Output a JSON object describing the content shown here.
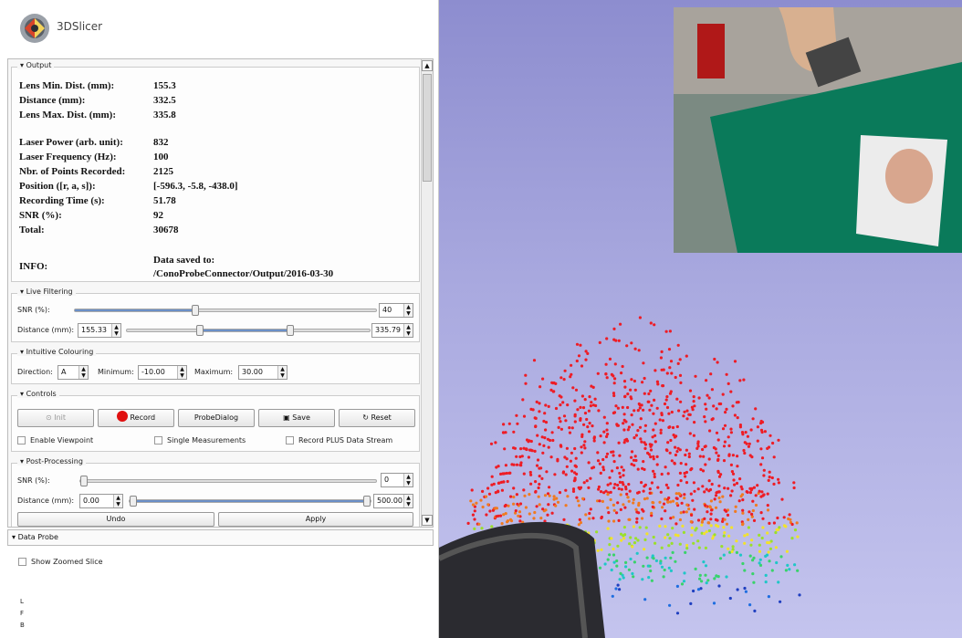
{
  "app": {
    "name": "3DSlicer"
  },
  "output": {
    "title": "Output",
    "rows": [
      {
        "label": "Lens Min. Dist. (mm):",
        "value": "155.3"
      },
      {
        "label": "Distance (mm):",
        "value": "332.5"
      },
      {
        "label": "Lens Max. Dist. (mm):",
        "value": "335.8"
      },
      {
        "label": "Laser Power (arb. unit):",
        "value": "832"
      },
      {
        "label": "Laser Frequency (Hz):",
        "value": "100"
      },
      {
        "label": "Nbr. of Points Recorded:",
        "value": "2125"
      },
      {
        "label": "Position ([r, a, s]):",
        "value": "[-596.3, -5.8, -438.0]"
      },
      {
        "label": "Recording Time (s):",
        "value": "51.78"
      },
      {
        "label": "SNR (%):",
        "value": "92"
      },
      {
        "label": "Total:",
        "value": "30678"
      }
    ],
    "info_label": "INFO:",
    "info_line1": "Data saved to:",
    "info_line2": "/ConoProbeConnector/Output/2016-03-30"
  },
  "live_filtering": {
    "title": "Live Filtering",
    "snr_label": "SNR (%):",
    "snr_value": "40",
    "snr_level": 0.4,
    "distance_label": "Distance (mm):",
    "dist_min": "155.33",
    "dist_max": "335.79"
  },
  "intuitive_colouring": {
    "title": "Intuitive Colouring",
    "direction_label": "Direction:",
    "direction_value": "A",
    "minimum_label": "Minimum:",
    "minimum_value": "-10.00",
    "maximum_label": "Maximum:",
    "maximum_value": "30.00"
  },
  "controls": {
    "title": "Controls",
    "init": "Init",
    "record": "Record",
    "probe_dialog": "ProbeDialog",
    "save": "Save",
    "reset": "Reset",
    "enable_viewpoint": "Enable Viewpoint",
    "single_measurements": "Single Measurements",
    "record_plus": "Record PLUS Data Stream"
  },
  "post_processing": {
    "title": "Post-Processing",
    "snr_label": "SNR (%):",
    "snr_value": "0",
    "distance_label": "Distance (mm):",
    "dist_min": "0.00",
    "dist_max": "500.00",
    "undo": "Undo",
    "apply": "Apply"
  },
  "data_probe": {
    "title": "Data Probe",
    "show_zoomed": "Show Zoomed Slice",
    "letters": [
      "L",
      "F",
      "B"
    ]
  },
  "colors": {
    "record_dot": "#e01010",
    "point_red": "#ee1c25",
    "viewport_bg": "#a9a9df"
  }
}
